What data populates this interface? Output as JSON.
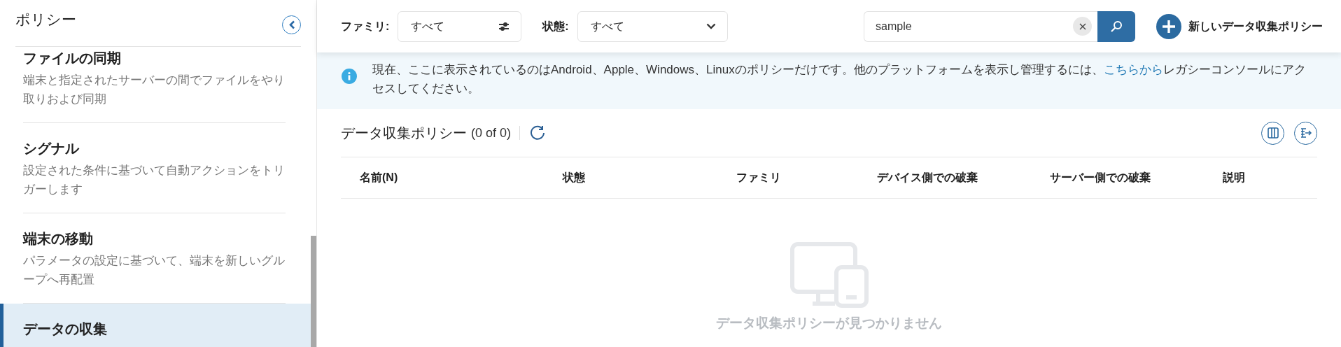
{
  "sidebar": {
    "title": "ポリシー",
    "items": [
      {
        "title": "ファイルの同期",
        "description": "端末と指定されたサーバーの間でファイルをやり取りおよび同期",
        "selected": false
      },
      {
        "title": "シグナル",
        "description": "設定された条件に基づいて自動アクションをトリガーします",
        "selected": false
      },
      {
        "title": "端末の移動",
        "description": "パラメータの設定に基づいて、端末を新しいグループへ再配置",
        "selected": false
      },
      {
        "title": "データの収集",
        "selected": true
      }
    ]
  },
  "filters": [
    {
      "label": "ファミリ:",
      "value": "すべて",
      "kind": "adjust"
    },
    {
      "label": "状態:",
      "value": "すべて",
      "kind": "dropdown"
    }
  ],
  "search": {
    "value": "sample"
  },
  "new_button": "新しいデータ収集ポリシー",
  "notice": {
    "text": "現在、ここに表示されているのはAndroid、Apple、Windows、Linuxのポリシーだけです。他のプラットフォームを表示し管理するには、",
    "link": "こちらから",
    "after": "レガシーコンソールにアクセスしてください。"
  },
  "list": {
    "title": "データ収集ポリシー",
    "count": "(0 of 0)",
    "columns": [
      "名前(N)",
      "状態",
      "ファミリ",
      "デバイス側での破棄",
      "サーバー側での破棄",
      "説明"
    ],
    "empty_message": "データ収集ポリシーが見つかりません"
  }
}
